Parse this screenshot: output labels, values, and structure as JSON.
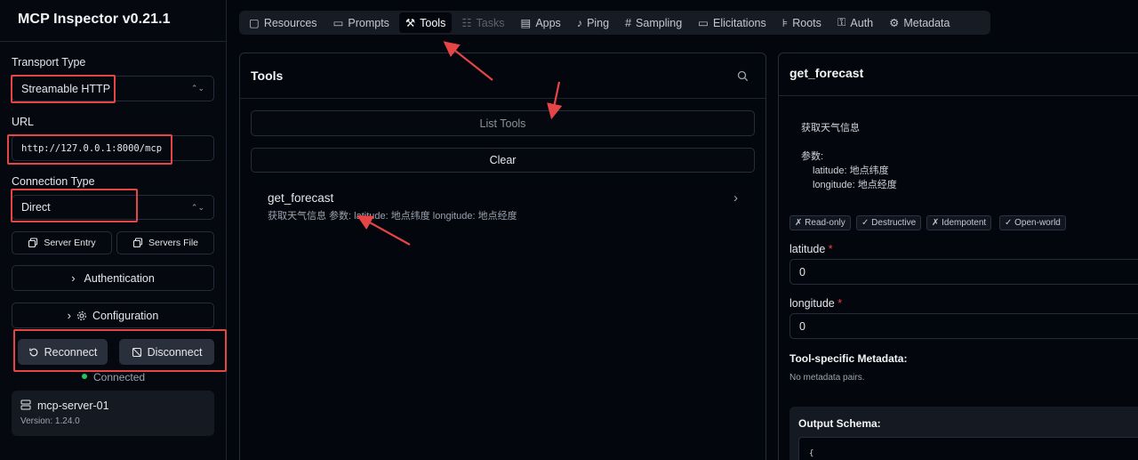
{
  "app": {
    "title": "MCP Inspector v0.21.1"
  },
  "sidebar": {
    "transport_label": "Transport Type",
    "transport_value": "Streamable HTTP",
    "url_label": "URL",
    "url_value": "http://127.0.0.1:8000/mcp",
    "connection_label": "Connection Type",
    "connection_value": "Direct",
    "server_entry_label": "Server Entry",
    "servers_file_label": "Servers File",
    "authentication_label": "Authentication",
    "configuration_label": "Configuration",
    "reconnect_label": "Reconnect",
    "disconnect_label": "Disconnect",
    "status_text": "Connected",
    "status_color": "#22c55e",
    "server_name": "mcp-server-01",
    "server_version": "Version: 1.24.0"
  },
  "tabs": [
    {
      "label": "Resources",
      "icon": "file-icon"
    },
    {
      "label": "Prompts",
      "icon": "message-icon"
    },
    {
      "label": "Tools",
      "icon": "wrench-icon",
      "active": true
    },
    {
      "label": "Tasks",
      "icon": "list-todo-icon",
      "disabled": true
    },
    {
      "label": "Apps",
      "icon": "app-window-icon"
    },
    {
      "label": "Ping",
      "icon": "bell-icon"
    },
    {
      "label": "Sampling",
      "icon": "hash-icon"
    },
    {
      "label": "Elicitations",
      "icon": "message-square-icon"
    },
    {
      "label": "Roots",
      "icon": "folder-tree-icon"
    },
    {
      "label": "Auth",
      "icon": "key-icon"
    },
    {
      "label": "Metadata",
      "icon": "gear-icon"
    }
  ],
  "tools_panel": {
    "title": "Tools",
    "list_tools_label": "List Tools",
    "clear_label": "Clear",
    "tool_name": "get_forecast",
    "tool_desc": "获取天气信息 参数: latitude: 地点纬度 longitude: 地点经度"
  },
  "detail_panel": {
    "title": "get_forecast",
    "desc_line1": "获取天气信息",
    "desc_line2": "参数:",
    "desc_line3": "latitude: 地点纬度",
    "desc_line4": "longitude: 地点经度",
    "badges": [
      "✗ Read-only",
      "✓ Destructive",
      "✗ Idempotent",
      "✓ Open-world"
    ],
    "latitude_label": "latitude",
    "latitude_value": "0",
    "longitude_label": "longitude",
    "longitude_value": "0",
    "required_mark": "*",
    "metadata_title": "Tool-specific Metadata:",
    "metadata_empty": "No metadata pairs.",
    "output_schema_title": "Output Schema:",
    "output_schema_first_line": "{"
  },
  "colors": {
    "annotation_red": "#e64545",
    "accent_green": "#22c55e"
  }
}
